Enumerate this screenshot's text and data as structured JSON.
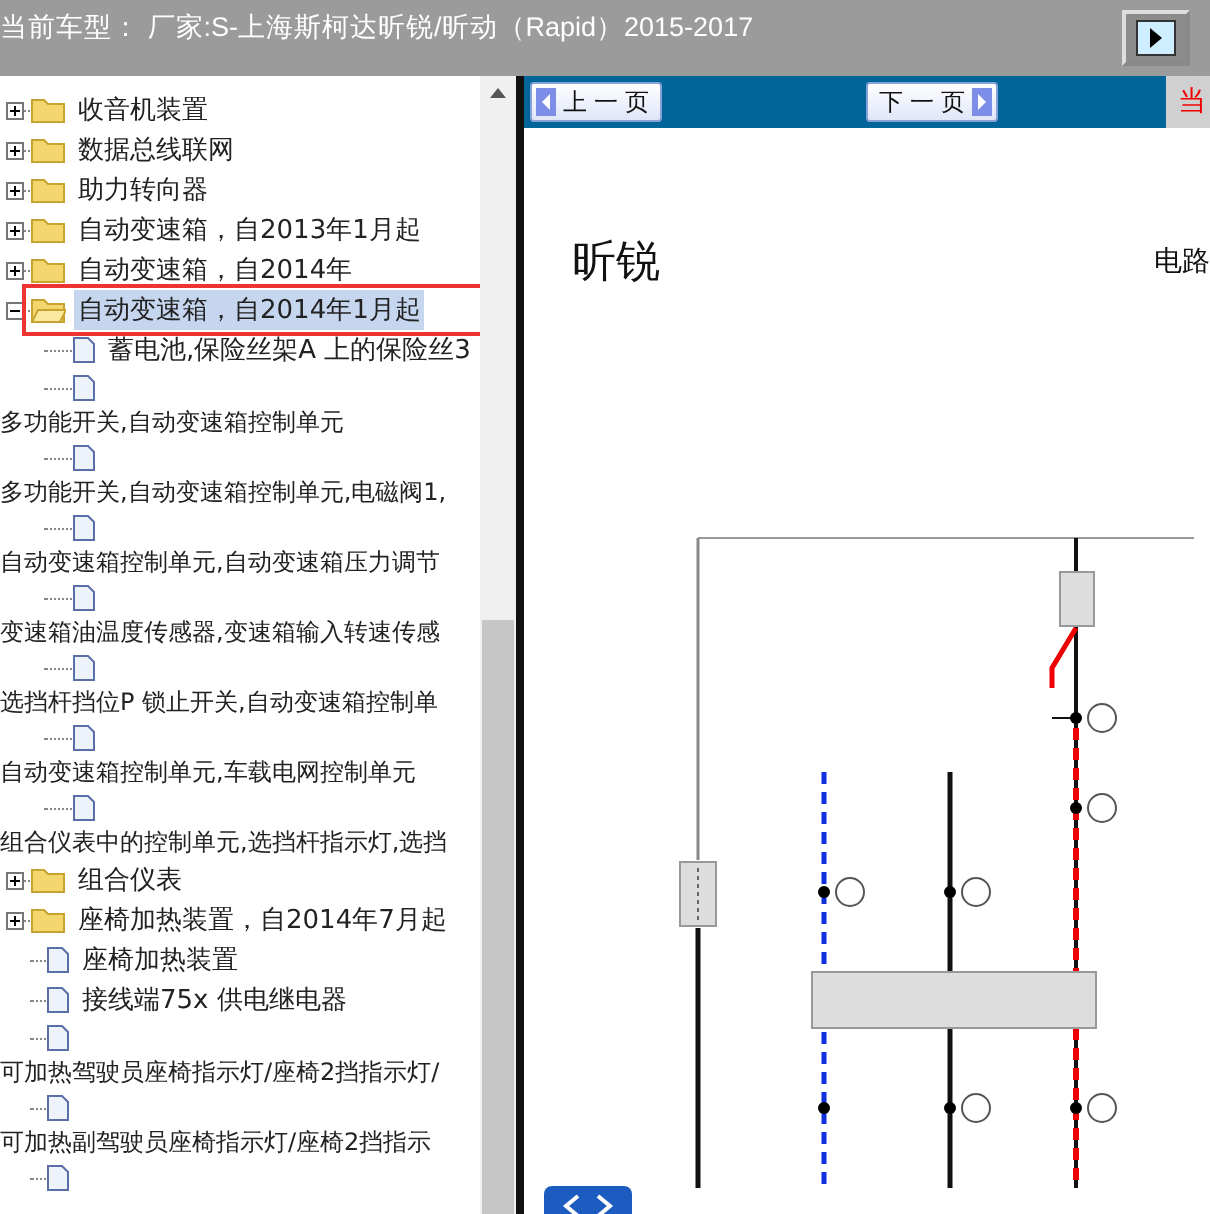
{
  "header": {
    "title": "当前车型： 厂家:S-上海斯柯达昕锐/昕动（Rapid）2015-2017"
  },
  "tree": [
    {
      "kind": "folder",
      "label": "收音机装置",
      "expanded": false,
      "selected": false
    },
    {
      "kind": "folder",
      "label": "数据总线联网",
      "expanded": false,
      "selected": false
    },
    {
      "kind": "folder",
      "label": "助力转向器",
      "expanded": false,
      "selected": false
    },
    {
      "kind": "folder",
      "label": "自动变速箱，自2013年1月起",
      "expanded": false,
      "selected": false
    },
    {
      "kind": "folder",
      "label": "自动变速箱，自2014年",
      "expanded": false,
      "selected": false
    },
    {
      "kind": "folder",
      "label": "自动变速箱，自2014年1月起",
      "expanded": true,
      "selected": true,
      "children": [
        {
          "kind": "doc",
          "label": "蓄电池,保险丝架A 上的保险丝3"
        },
        {
          "kind": "doc"
        },
        {
          "kind": "caption",
          "label": "多功能开关,自动变速箱控制单元"
        },
        {
          "kind": "doc"
        },
        {
          "kind": "caption",
          "label": "多功能开关,自动变速箱控制单元,电磁阀1,"
        },
        {
          "kind": "doc"
        },
        {
          "kind": "caption",
          "label": "自动变速箱控制单元,自动变速箱压力调节"
        },
        {
          "kind": "doc"
        },
        {
          "kind": "caption",
          "label": "变速箱油温度传感器,变速箱输入转速传感"
        },
        {
          "kind": "doc"
        },
        {
          "kind": "caption",
          "label": "选挡杆挡位P 锁止开关,自动变速箱控制单"
        },
        {
          "kind": "doc"
        },
        {
          "kind": "caption",
          "label": "自动变速箱控制单元,车载电网控制单元"
        },
        {
          "kind": "doc"
        },
        {
          "kind": "caption",
          "label": "组合仪表中的控制单元,选挡杆指示灯,选挡"
        }
      ]
    },
    {
      "kind": "folder",
      "label": "组合仪表",
      "expanded": false,
      "selected": false
    },
    {
      "kind": "folder",
      "label": "座椅加热装置，自2014年7月起",
      "expanded": false,
      "selected": false
    },
    {
      "kind": "doc",
      "label": "座椅加热装置"
    },
    {
      "kind": "doc",
      "label": "接线端75x 供电继电器"
    },
    {
      "kind": "doc"
    },
    {
      "kind": "caption",
      "label": "可加热驾驶员座椅指示灯/座椅2挡指示灯/"
    },
    {
      "kind": "doc"
    },
    {
      "kind": "caption",
      "label": "可加热副驾驶员座椅指示灯/座椅2挡指示"
    },
    {
      "kind": "doc"
    }
  ],
  "nav": {
    "prev": "上 一 页",
    "next": "下 一 页",
    "current": "当"
  },
  "document": {
    "title": "昕锐",
    "subtitle": "电路"
  }
}
